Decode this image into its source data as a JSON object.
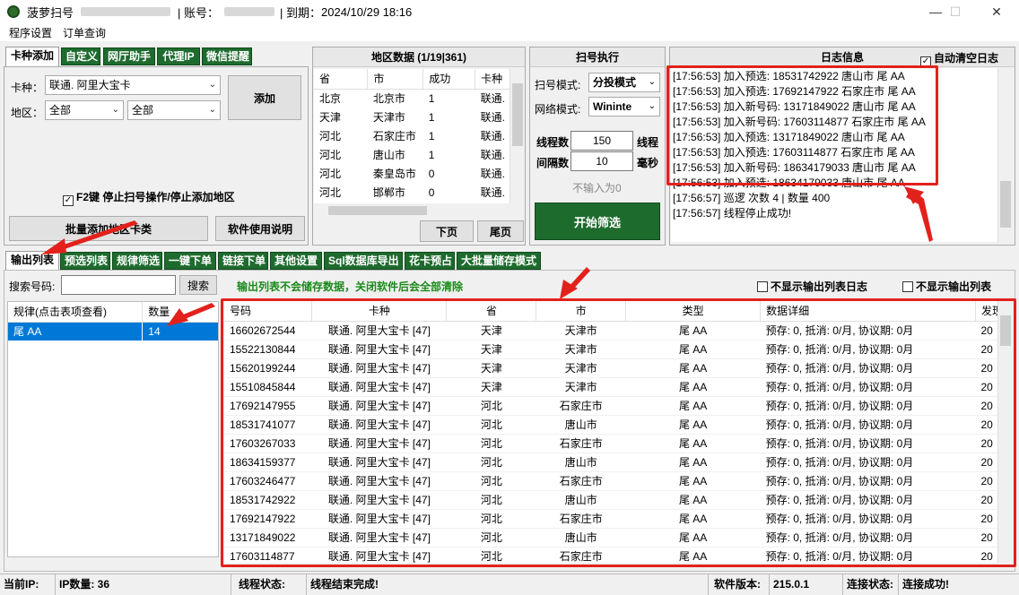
{
  "window": {
    "app_name": "菠萝扫号",
    "account_label": "| 账号：",
    "expiry_label": "| 到期：",
    "expiry_value": "2024/10/29 18:16"
  },
  "menu": [
    "程序设置",
    "订单查询"
  ],
  "top_tabs": [
    "卡种添加",
    "自定义",
    "网厅助手",
    "代理IP",
    "微信提醒"
  ],
  "card_add": {
    "card_type_label": "卡种：",
    "card_type_value": "联通. 阿里大宝卡",
    "region_label": "地区：",
    "region_province": "全部",
    "region_city": "全部",
    "add_button": "添加",
    "f2_check": "F2键 停止扫号操作/停止添加地区",
    "batch_button": "批量添加地区卡类",
    "manual_button": "软件使用说明"
  },
  "region_data": {
    "title": "地区数据 (1/19|361)",
    "columns": [
      "省",
      "市",
      "成功",
      "卡种"
    ],
    "rows": [
      [
        "北京",
        "北京市",
        "1",
        "联通."
      ],
      [
        "天津",
        "天津市",
        "1",
        "联通."
      ],
      [
        "河北",
        "石家庄市",
        "1",
        "联通."
      ],
      [
        "河北",
        "唐山市",
        "1",
        "联通."
      ],
      [
        "河北",
        "秦皇岛市",
        "0",
        "联通."
      ],
      [
        "河北",
        "邯郸市",
        "0",
        "联通."
      ]
    ],
    "next_button": "下页",
    "last_button": "尾页"
  },
  "scan_exec": {
    "title": "扫号执行",
    "mode_label": "扫号模式:",
    "mode_value": "分投模式",
    "net_label": "网络模式:",
    "net_value": "Wininte",
    "threads_label": "线程数",
    "threads_value": "150",
    "threads_unit": "线程",
    "interval_label": "间隔数",
    "interval_value": "10",
    "interval_unit": "毫秒",
    "hint": "不输入为0",
    "start_button": "开始筛选"
  },
  "log": {
    "title": "日志信息",
    "auto_clear": "自动清空日志",
    "lines": [
      "[17:56:53] 加入预选: 18531742922 唐山市 尾 AA",
      "[17:56:53] 加入预选: 17692147922 石家庄市 尾 AA",
      "[17:56:53] 加入新号码: 13171849022 唐山市 尾 AA",
      "[17:56:53] 加入新号码: 17603114877 石家庄市 尾 AA",
      "[17:56:53] 加入预选: 13171849022 唐山市 尾 AA",
      "[17:56:53] 加入预选: 17603114877 石家庄市 尾 AA",
      "[17:56:53] 加入新号码: 18634179033 唐山市 尾 AA",
      "[17:56:53] 加入预选: 18634179033 唐山市 尾 AA",
      "[17:56:57] 巡逻 次数 4 | 数量 400",
      "[17:56:57] 线程停止成功!"
    ]
  },
  "bottom_tabs": [
    "输出列表",
    "预选列表",
    "规律筛选",
    "一键下单",
    "链接下单",
    "其他设置",
    "Sql数据库导出",
    "花卡预占",
    "大批量储存模式"
  ],
  "search": {
    "label": "搜索号码:",
    "placeholder": "",
    "button": "搜索",
    "notice": "输出列表不会储存数据，关闭软件后会全部清除",
    "no_log_check": "不显示输出列表日志",
    "no_list_check": "不显示输出列表"
  },
  "rules_table": {
    "columns": [
      "规律(点击表项查看)",
      "数量"
    ],
    "rows": [
      [
        "尾 AA",
        "14"
      ]
    ]
  },
  "output_table": {
    "columns": [
      "号码",
      "卡种",
      "省",
      "市",
      "类型",
      "数据详细",
      "发现"
    ],
    "rows": [
      [
        "16602672544",
        "联通. 阿里大宝卡 [47]",
        "天津",
        "天津市",
        "尾 AA",
        "预存: 0, 抵消: 0/月, 协议期: 0月",
        "20"
      ],
      [
        "15522130844",
        "联通. 阿里大宝卡 [47]",
        "天津",
        "天津市",
        "尾 AA",
        "预存: 0, 抵消: 0/月, 协议期: 0月",
        "20"
      ],
      [
        "15620199244",
        "联通. 阿里大宝卡 [47]",
        "天津",
        "天津市",
        "尾 AA",
        "预存: 0, 抵消: 0/月, 协议期: 0月",
        "20"
      ],
      [
        "15510845844",
        "联通. 阿里大宝卡 [47]",
        "天津",
        "天津市",
        "尾 AA",
        "预存: 0, 抵消: 0/月, 协议期: 0月",
        "20"
      ],
      [
        "17692147955",
        "联通. 阿里大宝卡 [47]",
        "河北",
        "石家庄市",
        "尾 AA",
        "预存: 0, 抵消: 0/月, 协议期: 0月",
        "20"
      ],
      [
        "18531741077",
        "联通. 阿里大宝卡 [47]",
        "河北",
        "唐山市",
        "尾 AA",
        "预存: 0, 抵消: 0/月, 协议期: 0月",
        "20"
      ],
      [
        "17603267033",
        "联通. 阿里大宝卡 [47]",
        "河北",
        "石家庄市",
        "尾 AA",
        "预存: 0, 抵消: 0/月, 协议期: 0月",
        "20"
      ],
      [
        "18634159377",
        "联通. 阿里大宝卡 [47]",
        "河北",
        "唐山市",
        "尾 AA",
        "预存: 0, 抵消: 0/月, 协议期: 0月",
        "20"
      ],
      [
        "17603246477",
        "联通. 阿里大宝卡 [47]",
        "河北",
        "石家庄市",
        "尾 AA",
        "预存: 0, 抵消: 0/月, 协议期: 0月",
        "20"
      ],
      [
        "18531742922",
        "联通. 阿里大宝卡 [47]",
        "河北",
        "唐山市",
        "尾 AA",
        "预存: 0, 抵消: 0/月, 协议期: 0月",
        "20"
      ],
      [
        "17692147922",
        "联通. 阿里大宝卡 [47]",
        "河北",
        "石家庄市",
        "尾 AA",
        "预存: 0, 抵消: 0/月, 协议期: 0月",
        "20"
      ],
      [
        "13171849022",
        "联通. 阿里大宝卡 [47]",
        "河北",
        "唐山市",
        "尾 AA",
        "预存: 0, 抵消: 0/月, 协议期: 0月",
        "20"
      ],
      [
        "17603114877",
        "联通. 阿里大宝卡 [47]",
        "河北",
        "石家庄市",
        "尾 AA",
        "预存: 0, 抵消: 0/月, 协议期: 0月",
        "20"
      ]
    ]
  },
  "status": {
    "ip_label": "当前IP:",
    "ipcount_label": "IP数量: 36",
    "thread_label": "线程状态:",
    "thread_value": "线程结束完成!",
    "version_label": "软件版本:",
    "version_value": "215.0.1",
    "conn_label": "连接状态:",
    "conn_value": "连接成功!"
  },
  "colors": {
    "tab_green": "#1e6b2e",
    "highlight_red": "#e3211c",
    "notice_green": "#1a8a1a",
    "selection_blue": "#0078d7"
  }
}
